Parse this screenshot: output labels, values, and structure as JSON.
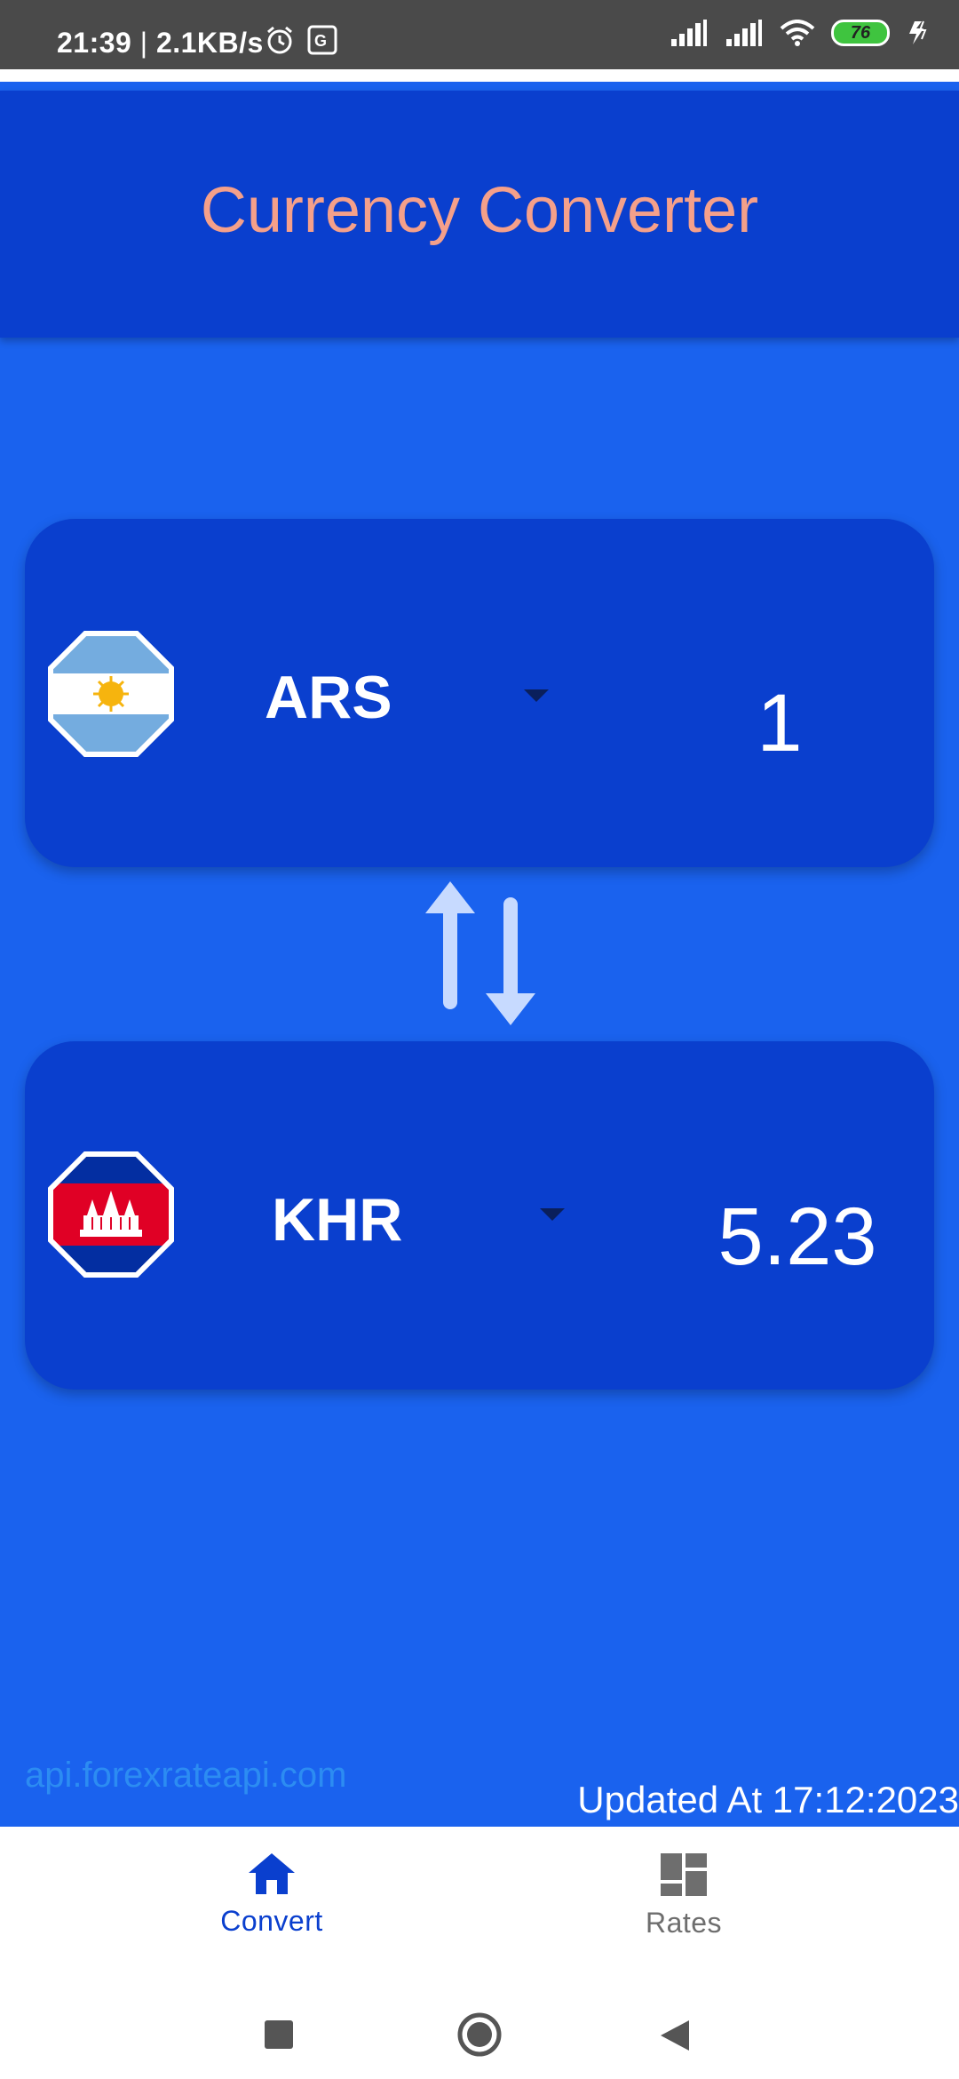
{
  "status_bar": {
    "time": "21:39",
    "speed": "2.1KB/s",
    "battery": "76"
  },
  "app_bar": {
    "title": "Currency Converter"
  },
  "converter": {
    "from": {
      "code": "ARS",
      "amount": "1",
      "flag": "argentina-flag-icon"
    },
    "to": {
      "code": "KHR",
      "amount": "5.23",
      "flag": "cambodia-flag-icon"
    }
  },
  "footer": {
    "api_source": "api.forexrateapi.com",
    "updated": "Updated At 17:12:2023"
  },
  "bottom_nav": {
    "convert_label": "Convert",
    "rates_label": "Rates"
  },
  "colors": {
    "background": "#1A62EE",
    "card": "#0A3FCE",
    "title": "#F5A08A",
    "link": "#2C8CF2",
    "active_nav": "#0A3FCE"
  }
}
